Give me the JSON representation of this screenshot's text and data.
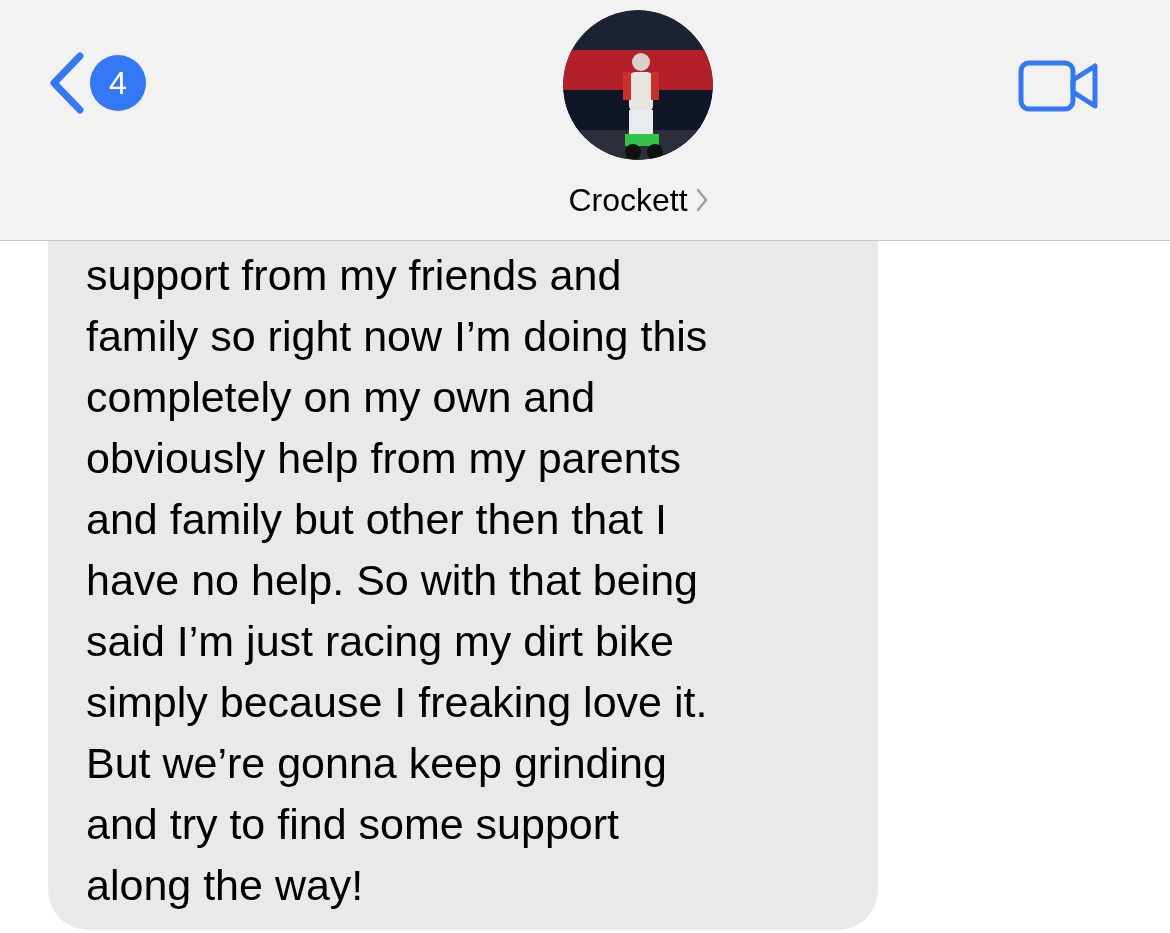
{
  "header": {
    "back_badge": "4",
    "contact_name": "Crockett"
  },
  "messages": [
    {
      "kind": "received",
      "text": "support from my friends and\nfamily so right now I’m doing this\ncompletely on my own and\nobviously help from my parents\nand family but other then that I\nhave no help. So with that being\nsaid I’m just racing my dirt bike\nsimply because I freaking love it.\nBut we’re gonna keep grinding\nand try to find some support\nalong the way!"
    }
  ]
}
